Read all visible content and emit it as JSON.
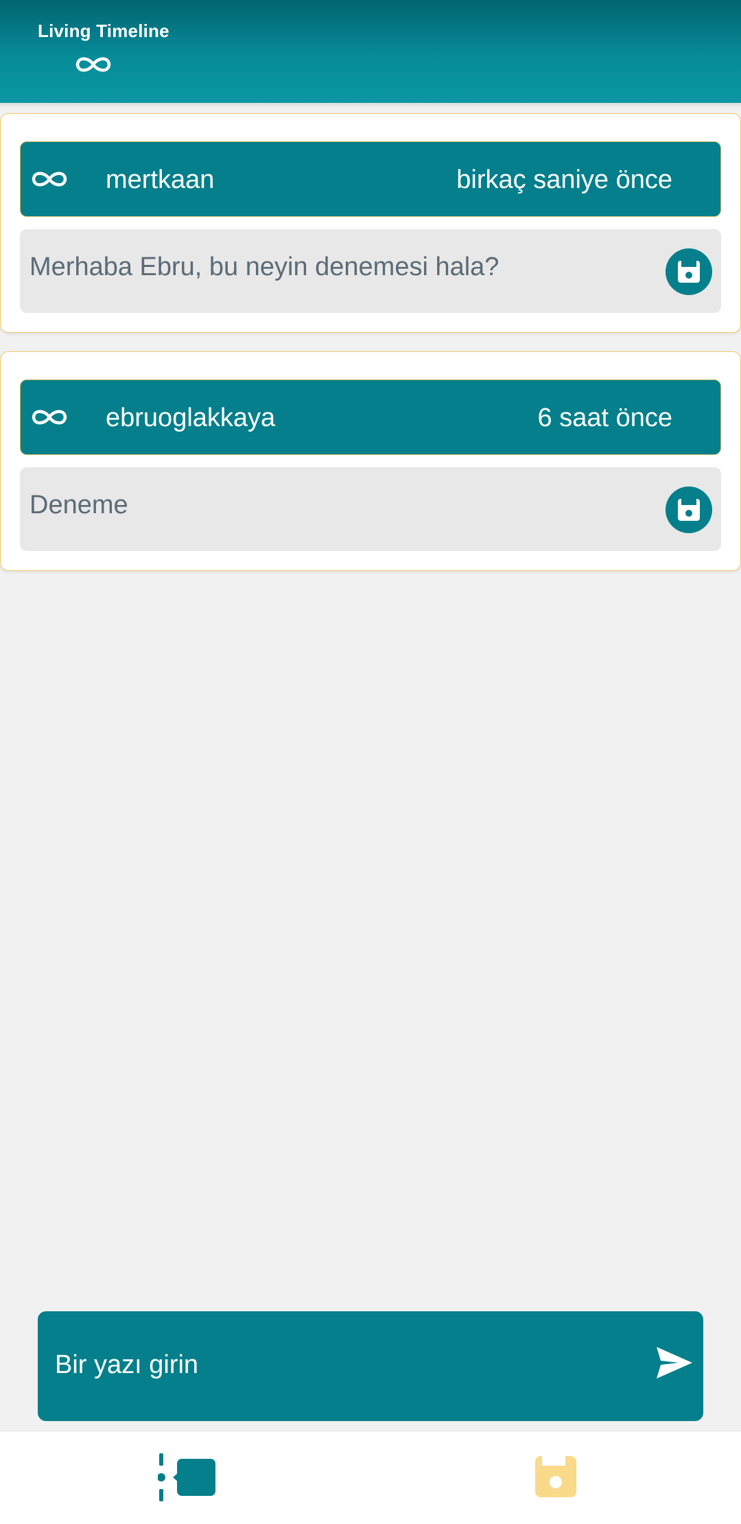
{
  "header": {
    "title": "Living Timeline",
    "icon": "infinity-icon"
  },
  "posts": [
    {
      "username": "mertkaan",
      "time": "birkaç saniye önce",
      "text": "Merhaba Ebru, bu neyin denemesi hala?",
      "icon": "infinity-icon",
      "action_icon": "save-icon"
    },
    {
      "username": "ebruoglakkaya",
      "time": "6 saat önce",
      "text": "Deneme",
      "icon": "infinity-icon",
      "action_icon": "save-icon"
    }
  ],
  "composer": {
    "placeholder": "Bir yazı girin",
    "send_icon": "send-icon"
  },
  "bottom_nav": {
    "items": [
      {
        "icon": "timeline-icon",
        "active": true
      },
      {
        "icon": "save-icon",
        "active": false
      }
    ]
  },
  "colors": {
    "primary": "#047f8b",
    "header_dark": "#036470",
    "accent_inactive": "#f9d98a",
    "card_border": "#f2c96a",
    "body_text": "#5b6b77",
    "background": "#f1f1f1"
  }
}
